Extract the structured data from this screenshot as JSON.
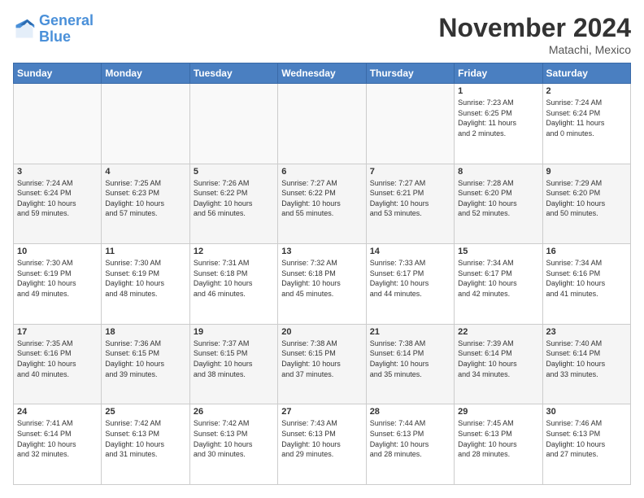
{
  "logo": {
    "text1": "General",
    "text2": "Blue"
  },
  "title": "November 2024",
  "location": "Matachi, Mexico",
  "days_header": [
    "Sunday",
    "Monday",
    "Tuesday",
    "Wednesday",
    "Thursday",
    "Friday",
    "Saturday"
  ],
  "weeks": [
    [
      {
        "day": "",
        "info": ""
      },
      {
        "day": "",
        "info": ""
      },
      {
        "day": "",
        "info": ""
      },
      {
        "day": "",
        "info": ""
      },
      {
        "day": "",
        "info": ""
      },
      {
        "day": "1",
        "info": "Sunrise: 7:23 AM\nSunset: 6:25 PM\nDaylight: 11 hours\nand 2 minutes."
      },
      {
        "day": "2",
        "info": "Sunrise: 7:24 AM\nSunset: 6:24 PM\nDaylight: 11 hours\nand 0 minutes."
      }
    ],
    [
      {
        "day": "3",
        "info": "Sunrise: 7:24 AM\nSunset: 6:24 PM\nDaylight: 10 hours\nand 59 minutes."
      },
      {
        "day": "4",
        "info": "Sunrise: 7:25 AM\nSunset: 6:23 PM\nDaylight: 10 hours\nand 57 minutes."
      },
      {
        "day": "5",
        "info": "Sunrise: 7:26 AM\nSunset: 6:22 PM\nDaylight: 10 hours\nand 56 minutes."
      },
      {
        "day": "6",
        "info": "Sunrise: 7:27 AM\nSunset: 6:22 PM\nDaylight: 10 hours\nand 55 minutes."
      },
      {
        "day": "7",
        "info": "Sunrise: 7:27 AM\nSunset: 6:21 PM\nDaylight: 10 hours\nand 53 minutes."
      },
      {
        "day": "8",
        "info": "Sunrise: 7:28 AM\nSunset: 6:20 PM\nDaylight: 10 hours\nand 52 minutes."
      },
      {
        "day": "9",
        "info": "Sunrise: 7:29 AM\nSunset: 6:20 PM\nDaylight: 10 hours\nand 50 minutes."
      }
    ],
    [
      {
        "day": "10",
        "info": "Sunrise: 7:30 AM\nSunset: 6:19 PM\nDaylight: 10 hours\nand 49 minutes."
      },
      {
        "day": "11",
        "info": "Sunrise: 7:30 AM\nSunset: 6:19 PM\nDaylight: 10 hours\nand 48 minutes."
      },
      {
        "day": "12",
        "info": "Sunrise: 7:31 AM\nSunset: 6:18 PM\nDaylight: 10 hours\nand 46 minutes."
      },
      {
        "day": "13",
        "info": "Sunrise: 7:32 AM\nSunset: 6:18 PM\nDaylight: 10 hours\nand 45 minutes."
      },
      {
        "day": "14",
        "info": "Sunrise: 7:33 AM\nSunset: 6:17 PM\nDaylight: 10 hours\nand 44 minutes."
      },
      {
        "day": "15",
        "info": "Sunrise: 7:34 AM\nSunset: 6:17 PM\nDaylight: 10 hours\nand 42 minutes."
      },
      {
        "day": "16",
        "info": "Sunrise: 7:34 AM\nSunset: 6:16 PM\nDaylight: 10 hours\nand 41 minutes."
      }
    ],
    [
      {
        "day": "17",
        "info": "Sunrise: 7:35 AM\nSunset: 6:16 PM\nDaylight: 10 hours\nand 40 minutes."
      },
      {
        "day": "18",
        "info": "Sunrise: 7:36 AM\nSunset: 6:15 PM\nDaylight: 10 hours\nand 39 minutes."
      },
      {
        "day": "19",
        "info": "Sunrise: 7:37 AM\nSunset: 6:15 PM\nDaylight: 10 hours\nand 38 minutes."
      },
      {
        "day": "20",
        "info": "Sunrise: 7:38 AM\nSunset: 6:15 PM\nDaylight: 10 hours\nand 37 minutes."
      },
      {
        "day": "21",
        "info": "Sunrise: 7:38 AM\nSunset: 6:14 PM\nDaylight: 10 hours\nand 35 minutes."
      },
      {
        "day": "22",
        "info": "Sunrise: 7:39 AM\nSunset: 6:14 PM\nDaylight: 10 hours\nand 34 minutes."
      },
      {
        "day": "23",
        "info": "Sunrise: 7:40 AM\nSunset: 6:14 PM\nDaylight: 10 hours\nand 33 minutes."
      }
    ],
    [
      {
        "day": "24",
        "info": "Sunrise: 7:41 AM\nSunset: 6:14 PM\nDaylight: 10 hours\nand 32 minutes."
      },
      {
        "day": "25",
        "info": "Sunrise: 7:42 AM\nSunset: 6:13 PM\nDaylight: 10 hours\nand 31 minutes."
      },
      {
        "day": "26",
        "info": "Sunrise: 7:42 AM\nSunset: 6:13 PM\nDaylight: 10 hours\nand 30 minutes."
      },
      {
        "day": "27",
        "info": "Sunrise: 7:43 AM\nSunset: 6:13 PM\nDaylight: 10 hours\nand 29 minutes."
      },
      {
        "day": "28",
        "info": "Sunrise: 7:44 AM\nSunset: 6:13 PM\nDaylight: 10 hours\nand 28 minutes."
      },
      {
        "day": "29",
        "info": "Sunrise: 7:45 AM\nSunset: 6:13 PM\nDaylight: 10 hours\nand 28 minutes."
      },
      {
        "day": "30",
        "info": "Sunrise: 7:46 AM\nSunset: 6:13 PM\nDaylight: 10 hours\nand 27 minutes."
      }
    ]
  ]
}
